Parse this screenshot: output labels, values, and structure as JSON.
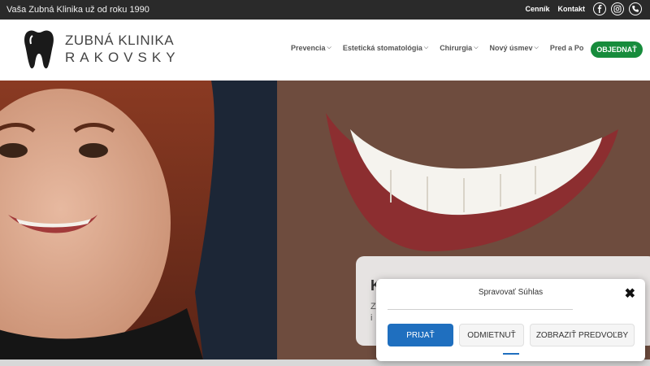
{
  "topbar": {
    "tagline": "Vaša Zubná Klinika už od roku 1990",
    "links": [
      "Cenník",
      "Kontakt"
    ],
    "social_icons": [
      "facebook-icon",
      "instagram-icon",
      "phone-icon"
    ]
  },
  "header": {
    "logo_line1": "ZUBNÁ KLINIKA",
    "logo_line2": "RAKOVSKY",
    "nav": [
      {
        "label": "Prevencia",
        "has_dropdown": true
      },
      {
        "label": "Estetická stomatológia",
        "has_dropdown": true
      },
      {
        "label": "Chirurgia",
        "has_dropdown": true
      },
      {
        "label": "Nový úsmev",
        "has_dropdown": true
      },
      {
        "label": "Pred a Po",
        "has_dropdown": false
      }
    ],
    "order_button": "OBJEDNAŤ"
  },
  "hero": {
    "heading_partial": "K",
    "text_partial_1": "Z",
    "text_partial_2": "i"
  },
  "cookie_dialog": {
    "title": "Spravovať Súhlas",
    "close_symbol": "✖",
    "accept": "PRIJAŤ",
    "deny": "ODMIETNUŤ",
    "preferences": "ZOBRAZIŤ PREDVOĽBY"
  },
  "colors": {
    "accent_green": "#178c3c",
    "accept_blue": "#1f6fbf",
    "topbar": "#2a2a2a"
  }
}
